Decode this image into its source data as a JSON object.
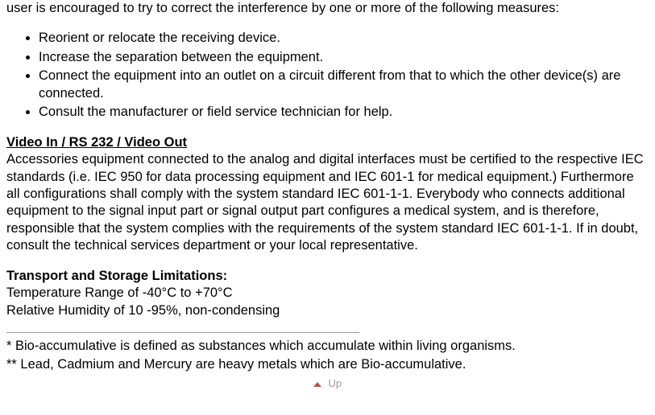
{
  "intro": "user is encouraged to try to correct the interference by one or more of the following measures:",
  "bullets": [
    "Reorient or relocate the receiving device.",
    "Increase the separation between the equipment.",
    "Connect the equipment into an outlet on a circuit different from that to which the other device(s) are connected.",
    "Consult the manufacturer or field service technician for help."
  ],
  "section1": {
    "title": "Video In / RS 232 / Video Out",
    "body": "Accessories equipment connected to the analog and digital interfaces must be certified to the respective IEC standards (i.e. IEC 950 for data processing equipment and IEC 601-1 for medical equipment.) Furthermore all configurations shall comply with the system standard IEC 601-1-1. Everybody who connects additional equipment to the signal input part or signal output part configures a medical system, and is therefore, responsible that the system complies with the requirements of the system standard IEC 601-1-1. If in doubt, consult the technical services department or your local representative."
  },
  "section2": {
    "title": "Transport and Storage Limitations:",
    "line1": "Temperature Range of -40°C to +70°C",
    "line2": "Relative Humidity of 10 -95%, non-condensing"
  },
  "footnotes": {
    "f1": "* Bio-accumulative is defined as substances which accumulate within living organisms.",
    "f2": "** Lead, Cadmium and Mercury are heavy metals which are Bio-accumulative."
  },
  "backLink": "Up"
}
